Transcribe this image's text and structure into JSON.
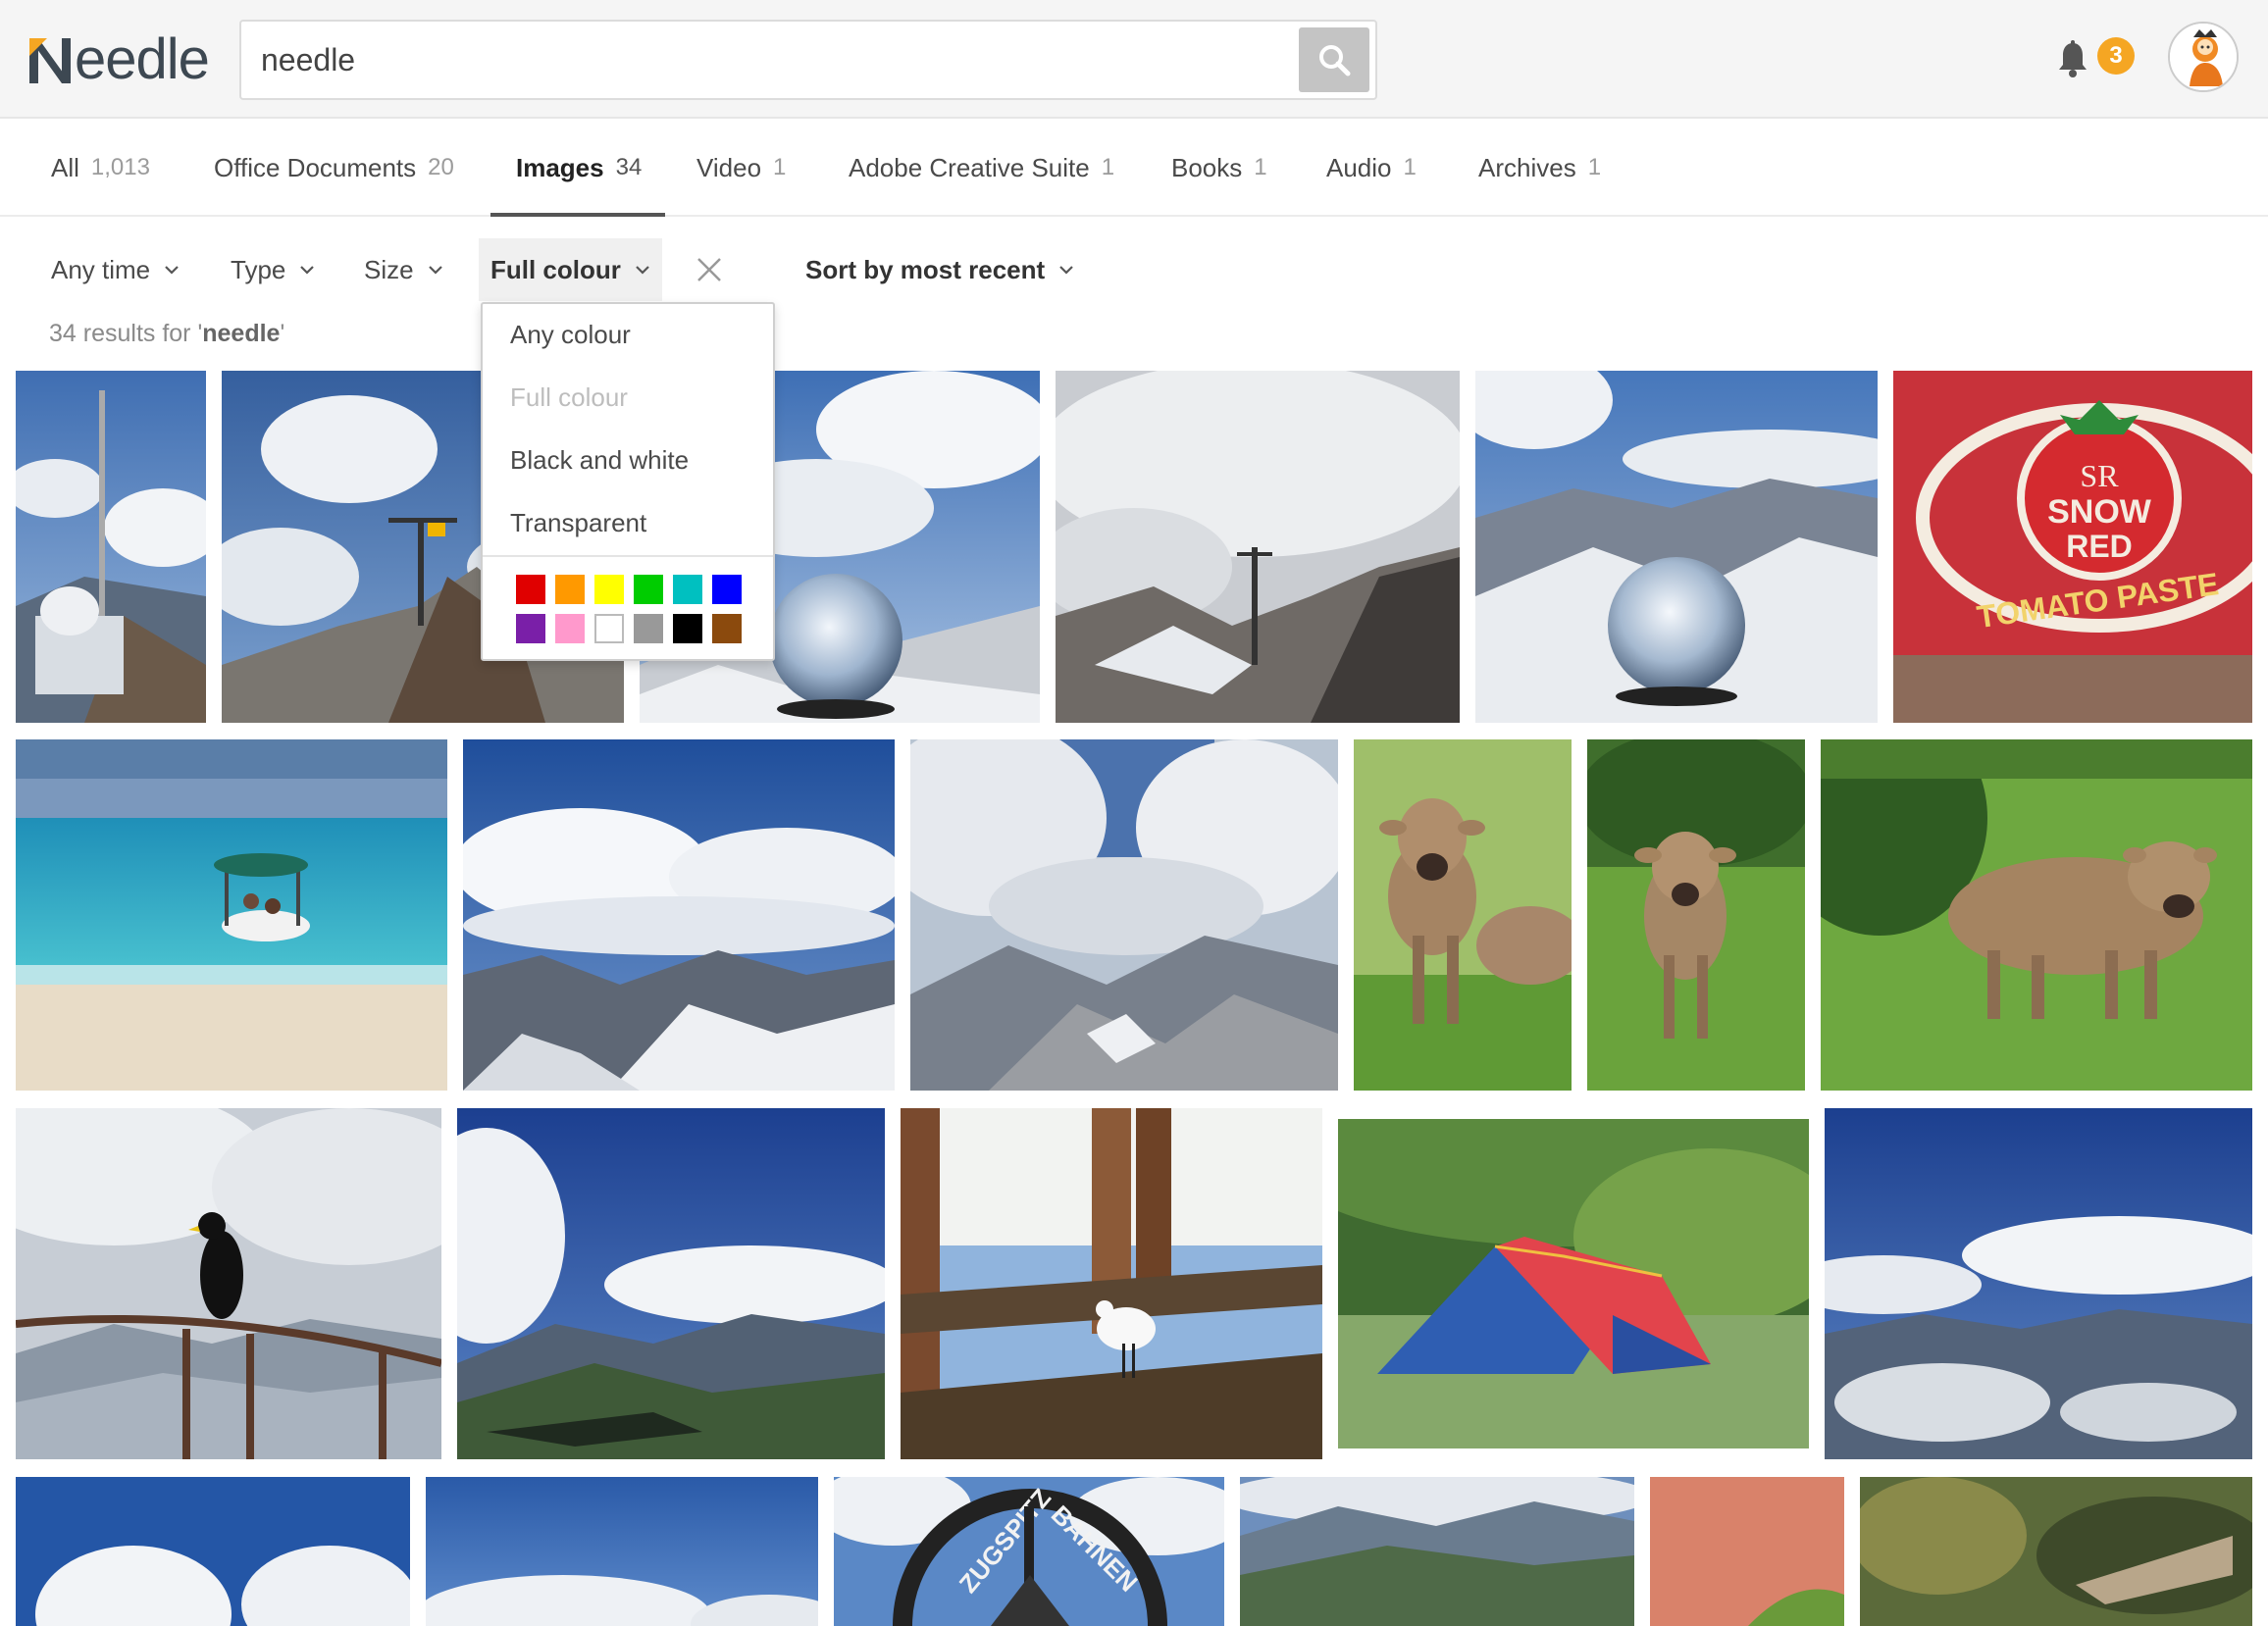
{
  "app": {
    "logo_text": "eedle"
  },
  "search": {
    "value": "needle",
    "placeholder": ""
  },
  "header": {
    "notification_count": "3"
  },
  "tabs": [
    {
      "label": "All",
      "count": "1,013"
    },
    {
      "label": "Office Documents",
      "count": "20"
    },
    {
      "label": "Images",
      "count": "34"
    },
    {
      "label": "Video",
      "count": "1"
    },
    {
      "label": "Adobe Creative Suite",
      "count": "1"
    },
    {
      "label": "Books",
      "count": "1"
    },
    {
      "label": "Audio",
      "count": "1"
    },
    {
      "label": "Archives",
      "count": "1"
    }
  ],
  "active_tab": "Images",
  "filters": {
    "time": "Any time",
    "type": "Type",
    "size": "Size",
    "colour": "Full colour",
    "sort": "Sort by most recent"
  },
  "results": {
    "prefix": "34 results for '",
    "query": "needle",
    "suffix": "'"
  },
  "colour_menu": {
    "items": [
      "Any colour",
      "Full colour",
      "Black and white",
      "Transparent"
    ],
    "disabled_item": "Full colour",
    "swatches": [
      {
        "name": "red",
        "hex": "#e00000"
      },
      {
        "name": "orange",
        "hex": "#ff9900"
      },
      {
        "name": "yellow",
        "hex": "#ffff00"
      },
      {
        "name": "green",
        "hex": "#00cc00"
      },
      {
        "name": "teal",
        "hex": "#00c0c0"
      },
      {
        "name": "blue",
        "hex": "#0000ff"
      },
      {
        "name": "purple",
        "hex": "#7a1fa8"
      },
      {
        "name": "pink",
        "hex": "#ff99cc"
      },
      {
        "name": "white",
        "hex": "#ffffff"
      },
      {
        "name": "gray",
        "hex": "#999999"
      },
      {
        "name": "black",
        "hex": "#000000"
      },
      {
        "name": "brown",
        "hex": "#8b4a0d"
      }
    ]
  },
  "sign_text": {
    "brand": "SR",
    "line1": "SNOW",
    "line2": "RED",
    "line3": "TOMATO PASTE"
  },
  "gate_text": {
    "left": "ZUGSPITZ",
    "right": "BAHNEN"
  },
  "colors": {
    "accent": "#f5a623",
    "header_bg": "#f5f5f5",
    "search_button": "#c4c4c4"
  }
}
